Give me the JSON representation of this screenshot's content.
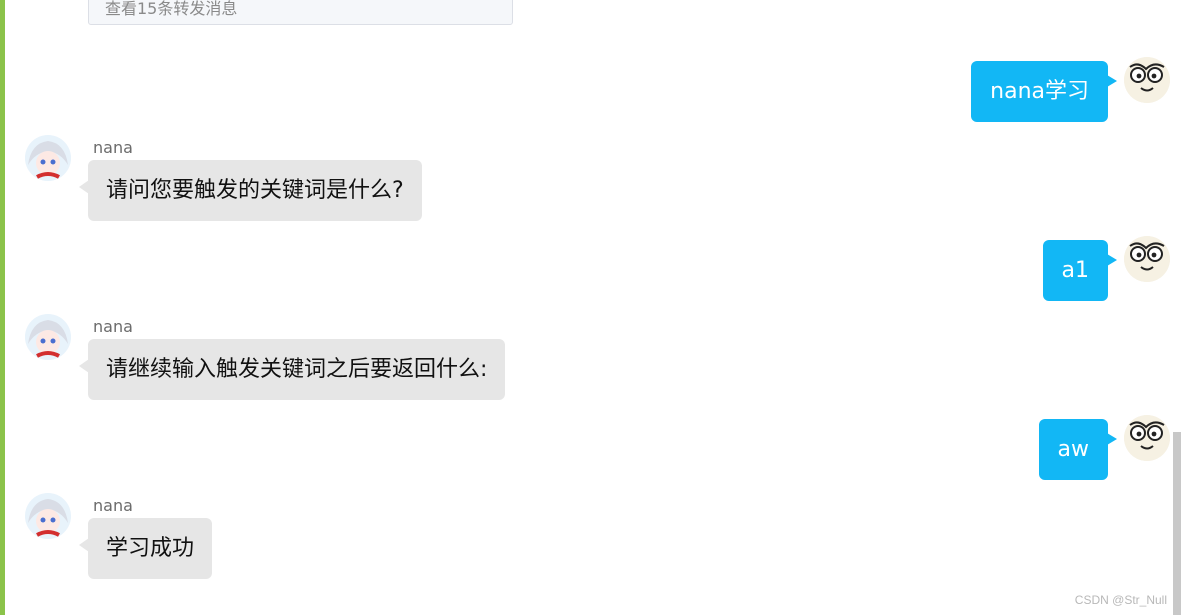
{
  "forward_card": {
    "label": "查看15条转发消息"
  },
  "messages": [
    {
      "side": "right",
      "text": "nana学习"
    },
    {
      "side": "left",
      "sender": "nana",
      "text": "请问您要触发的关键词是什么?"
    },
    {
      "side": "right",
      "text": "a1"
    },
    {
      "side": "left",
      "sender": "nana",
      "text": "请继续输入触发关键词之后要返回什么:"
    },
    {
      "side": "right",
      "text": "aw"
    },
    {
      "side": "left",
      "sender": "nana",
      "text": "学习成功"
    }
  ],
  "watermark": "CSDN @Str_Null",
  "colors": {
    "user_bubble": "#12b7f5",
    "bot_bubble": "#e6e6e6",
    "left_accent": "#8bc34a"
  },
  "icons": {
    "bot_avatar": "anime-girl-avatar-icon",
    "user_avatar": "cartoon-face-avatar-icon"
  }
}
